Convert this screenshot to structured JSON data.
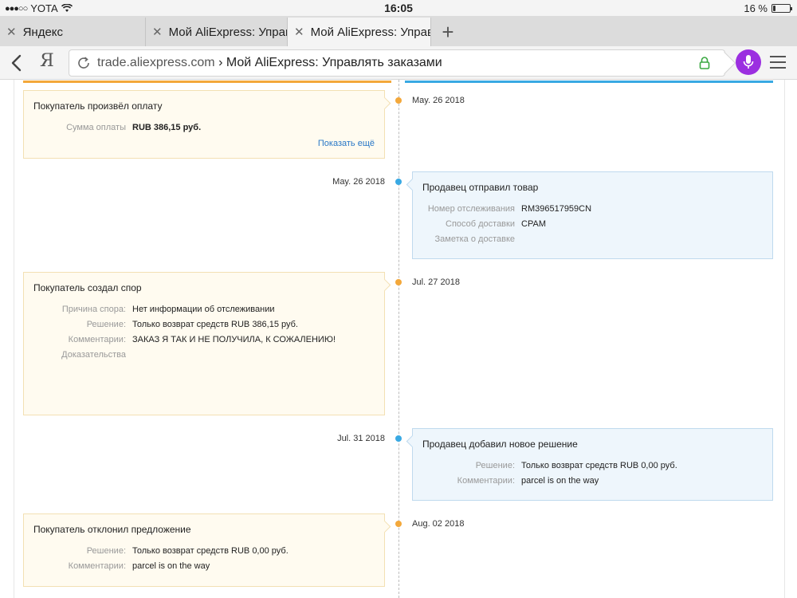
{
  "status_bar": {
    "carrier": "YOTA",
    "time": "16:05",
    "battery_percent": "16 %",
    "battery_level": 0.16
  },
  "tabs": [
    {
      "title": "Яндекс"
    },
    {
      "title": "Мой AliExpress: Управ"
    },
    {
      "title": "Мой AliExpress: Управ"
    }
  ],
  "address": {
    "domain": "trade.aliexpress.com",
    "separator": "›",
    "page_title": "Мой AliExpress: Управлять заказами",
    "yandex_letter": "Я"
  },
  "colors": {
    "buyer_accent": "#f3a83b",
    "seller_accent": "#39a9e3",
    "voice_button": "#9b2fe0",
    "link": "#2a78c7"
  },
  "events": [
    {
      "side": "buyer",
      "date": "May. 26 2018",
      "title": "Покупатель произвёл оплату",
      "rows": [
        {
          "label": "Сумма оплаты",
          "value": "RUB 386,15 руб."
        }
      ],
      "link": "Показать ещё"
    },
    {
      "side": "seller",
      "date": "May. 26 2018",
      "title": "Продавец отправил товар",
      "rows": [
        {
          "label": "Номер отслеживания",
          "value": "RM396517959CN"
        },
        {
          "label": "Способ доставки",
          "value": "СРАМ"
        },
        {
          "label": "Заметка о доставке",
          "value": ""
        }
      ]
    },
    {
      "side": "buyer",
      "date": "Jul. 27 2018",
      "title": "Покупатель создал спор",
      "rows": [
        {
          "label": "Причина спора:",
          "value": "Нет информации об отслеживании"
        },
        {
          "label": "Решение:",
          "value": "Только возврат средств RUB 386,15 руб."
        },
        {
          "label": "Комментарии:",
          "value": "ЗАКАЗ Я ТАК И НЕ ПОЛУЧИЛА, К СОЖАЛЕНИЮ!"
        },
        {
          "label": "Доказательства",
          "value": ""
        }
      ]
    },
    {
      "side": "seller",
      "date": "Jul. 31 2018",
      "title": "Продавец добавил новое решение",
      "rows": [
        {
          "label": "Решение:",
          "value": "Только возврат средств RUB 0,00 руб."
        },
        {
          "label": "Комментарии:",
          "value": "parcel is on the way"
        }
      ]
    },
    {
      "side": "buyer",
      "date": "Aug. 02 2018",
      "title": "Покупатель отклонил предложение",
      "rows": [
        {
          "label": "Решение:",
          "value": "Только возврат средств RUB 0,00 руб."
        },
        {
          "label": "Комментарии:",
          "value": "parcel is on the way"
        }
      ]
    }
  ]
}
